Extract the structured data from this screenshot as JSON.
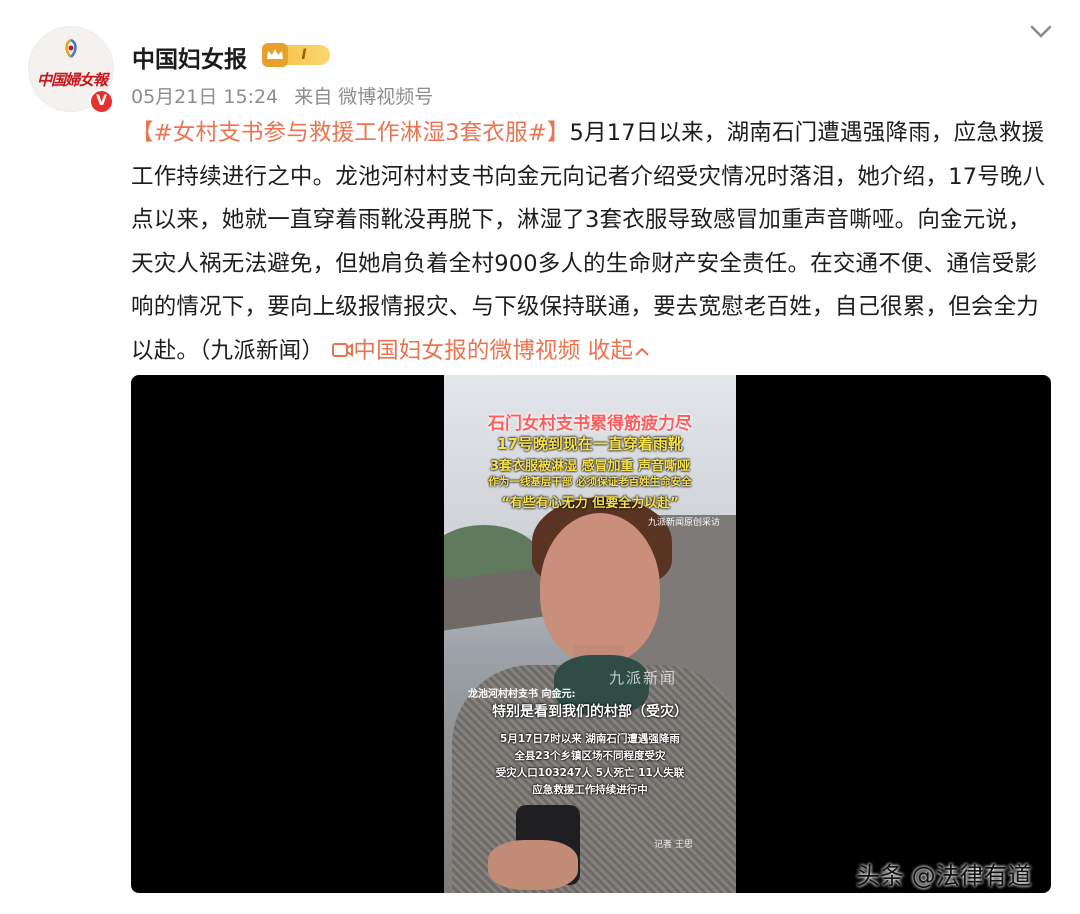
{
  "account": {
    "name": "中国妇女报",
    "avatar_logo_text": "中国婦女報",
    "member_level": "I",
    "verified_mark": "V"
  },
  "post_meta": {
    "date": "05月21日 15:24",
    "source": "来自 微博视频号"
  },
  "post": {
    "hashtag": "#女村支书参与救援工作淋湿3套衣服#",
    "open_bracket": "【",
    "close_bracket": "】",
    "body": "5月17日以来，湖南石门遭遇强降雨，应急救援工作持续进行之中。龙池河村村支书向金元向记者介绍受灾情况时落泪，她介绍，17号晚八点以来，她就一直穿着雨靴没再脱下，淋湿了3套衣服导致感冒加重声音嘶哑。向金元说，天灾人祸无法避免，但她肩负着全村900多人的生命财产安全责任。在交通不便、通信受影响的情况下，要向上级报情报灾、与下级保持联通，要去宽慰老百姓，自己很累，但会全力以赴。（九派新闻）",
    "video_link": "中国妇女报的微博视频",
    "collapse": "收起"
  },
  "video": {
    "captions": [
      "石门女村支书累得筋疲力尽",
      "17号晚到现在一直穿着雨靴",
      "3套衣服被淋湿 感冒加重 声音嘶哑",
      "作为一线基层干部 必须保证老百姓生命安全",
      "“有些有心无力 但要全力以赴”"
    ],
    "source_note": "九派新闻原创采访",
    "logo_text": "九派新闻",
    "speaker": "龙池河村村支书 向金元:",
    "subtitle": "特别是看到我们的村部（受灾）",
    "info_lines": [
      "5月17日7时以来 湖南石门遭遇强降雨",
      "全县23个乡镇区场不同程度受灾",
      "受灾人口103247人 5人死亡 11人失联",
      "应急救援工作持续进行中"
    ],
    "reporter": "记者 王思"
  },
  "watermark": "头条 @法律有道",
  "colors": {
    "link": "#eb7350",
    "verified": "#e8302d",
    "meta": "#8d8d8d"
  },
  "icons": [
    "chevron-down-icon",
    "video-link-icon",
    "collapse-chevron-icon",
    "crown-icon",
    "verified-icon"
  ]
}
